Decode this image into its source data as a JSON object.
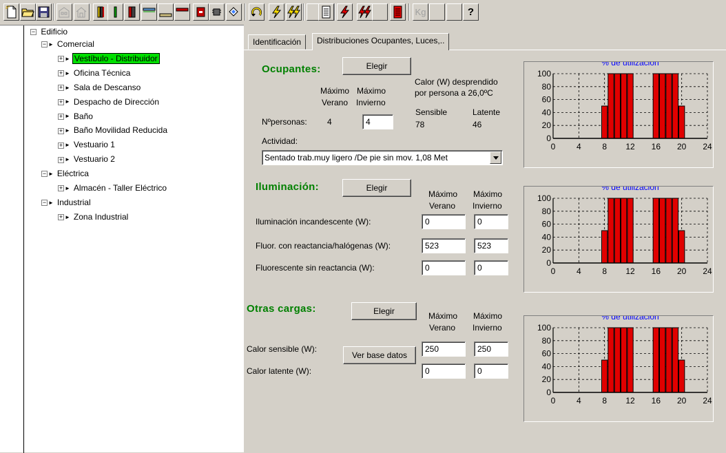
{
  "toolbar": {
    "icons": [
      "new-document-icon",
      "open-folder-icon",
      "save-disk-icon",
      "building-icon",
      "house-icon",
      "wall-layers-icon",
      "column-icon",
      "door-icon",
      "window-icon",
      "floor-icon",
      "roof-icon",
      "red-block-icon",
      "component-icon",
      "diamond-icon",
      "refresh-arrow-icon",
      "lightning-icon",
      "double-lightning-icon",
      "blank-icon",
      "report-icon",
      "lightning-red-icon",
      "double-lightning-red-icon",
      "blank-icon-2",
      "red-report-icon",
      "kg-icon",
      "blank-icon-3",
      "blank-icon-4",
      "help-icon"
    ],
    "kg_label": "Kg",
    "help_label": "?"
  },
  "tree": {
    "root": "Edificio",
    "items": [
      {
        "label": "Comercial",
        "level": 1
      },
      {
        "label": "Vestíbulo - Distribuidor",
        "level": 2,
        "selected": true
      },
      {
        "label": "Oficina Técnica",
        "level": 2
      },
      {
        "label": "Sala de Descanso",
        "level": 2
      },
      {
        "label": "Despacho de Dirección",
        "level": 2
      },
      {
        "label": "Baño",
        "level": 2
      },
      {
        "label": "Baño Movilidad Reducida",
        "level": 2
      },
      {
        "label": "Vestuario 1",
        "level": 2
      },
      {
        "label": "Vestuario 2",
        "level": 2
      },
      {
        "label": "Eléctrica",
        "level": 1
      },
      {
        "label": "Almacén - Taller Eléctrico",
        "level": 2
      },
      {
        "label": "Industrial",
        "level": 1
      },
      {
        "label": "Zona Industrial",
        "level": 2
      }
    ]
  },
  "tabs": [
    {
      "label": "Identificación",
      "active": false
    },
    {
      "label": "Distribuciones Ocupantes, Luces,..",
      "active": true
    }
  ],
  "ocupantes": {
    "title": "Ocupantes:",
    "choose": "Elegir",
    "max_summer_1": "Máximo",
    "max_summer_2": "Verano",
    "max_winter_1": "Máximo",
    "max_winter_2": "Invierno",
    "heat_1": "Calor (W) desprendido",
    "heat_2": "por persona a 26,0ºC",
    "sensible": "Sensible",
    "latente": "Latente",
    "sensible_value": "78",
    "latente_value": "46",
    "persons_label": "Nºpersonas:",
    "persons_summer": "4",
    "persons_winter": "4",
    "activity_label": "Actividad:",
    "activity_value": "Sentado trab.muy ligero /De pie sin mov.  1,08 Met"
  },
  "iluminacion": {
    "title": "Iluminación:",
    "choose": "Elegir",
    "max_summer_1": "Máximo",
    "max_summer_2": "Verano",
    "max_winter_1": "Máximo",
    "max_winter_2": "Invierno",
    "rows": [
      {
        "label": "Iluminación incandescente (W):",
        "summer": "0",
        "winter": "0"
      },
      {
        "label": "Fluor. con reactancia/halógenas (W):",
        "summer": "523",
        "winter": "523"
      },
      {
        "label": "Fluorescente sin reactancia (W):",
        "summer": "0",
        "winter": "0"
      }
    ]
  },
  "otras": {
    "title": "Otras cargas:",
    "choose": "Elegir",
    "max_summer_1": "Máximo",
    "max_summer_2": "Verano",
    "max_winter_1": "Máximo",
    "max_winter_2": "Invierno",
    "db_button": "Ver base datos",
    "rows": [
      {
        "label": "Calor sensible (W):",
        "summer": "250",
        "winter": "250"
      },
      {
        "label": "Calor latente (W):",
        "summer": "0",
        "winter": "0"
      }
    ]
  },
  "colors": {
    "bar": "#e00000",
    "grid": "#000000",
    "title": "#0000ff",
    "section": "#008000",
    "selected": "#00e000"
  },
  "chart_data": [
    {
      "type": "bar",
      "title": "% de utilización",
      "x": [
        8,
        9,
        10,
        11,
        12,
        16,
        17,
        18,
        19,
        20
      ],
      "values": [
        50,
        100,
        100,
        100,
        100,
        100,
        100,
        100,
        100,
        50
      ],
      "xticks": [
        0,
        4,
        8,
        12,
        16,
        20,
        24
      ],
      "yticks": [
        0,
        20,
        40,
        60,
        80,
        100
      ],
      "xlim": [
        0,
        24
      ],
      "ylim": [
        0,
        100
      ],
      "grid": true
    },
    {
      "type": "bar",
      "title": "% de utilización",
      "x": [
        8,
        9,
        10,
        11,
        12,
        16,
        17,
        18,
        19,
        20
      ],
      "values": [
        50,
        100,
        100,
        100,
        100,
        100,
        100,
        100,
        100,
        50
      ],
      "xticks": [
        0,
        4,
        8,
        12,
        16,
        20,
        24
      ],
      "yticks": [
        0,
        20,
        40,
        60,
        80,
        100
      ],
      "xlim": [
        0,
        24
      ],
      "ylim": [
        0,
        100
      ],
      "grid": true
    },
    {
      "type": "bar",
      "title": "% de utilización",
      "x": [
        8,
        9,
        10,
        11,
        12,
        16,
        17,
        18,
        19,
        20
      ],
      "values": [
        50,
        100,
        100,
        100,
        100,
        100,
        100,
        100,
        100,
        50
      ],
      "xticks": [
        0,
        4,
        8,
        12,
        16,
        20,
        24
      ],
      "yticks": [
        0,
        20,
        40,
        60,
        80,
        100
      ],
      "xlim": [
        0,
        24
      ],
      "ylim": [
        0,
        100
      ],
      "grid": true
    }
  ]
}
